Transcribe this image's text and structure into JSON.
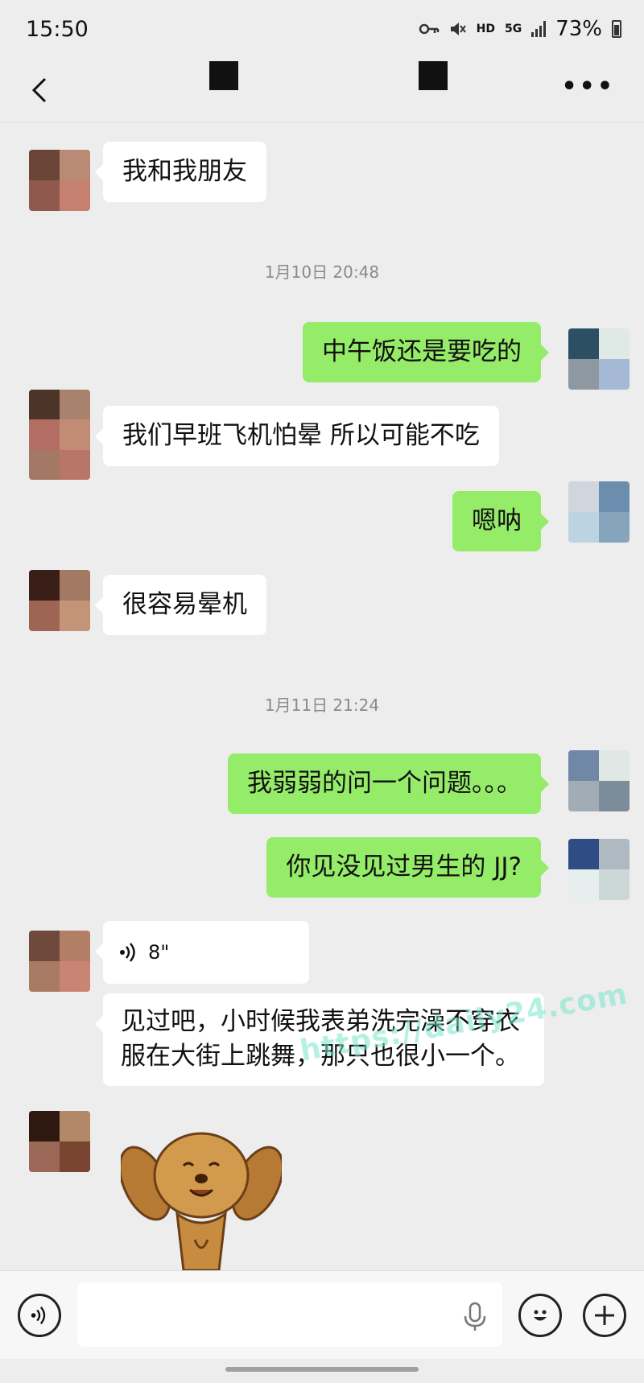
{
  "status": {
    "time": "15:50",
    "net_hd": "HD",
    "net_5g": "5G",
    "battery": "73%"
  },
  "messages": {
    "m1": "我和我朋友",
    "ts1": "1月10日 20:48",
    "m2": "中午饭还是要吃的",
    "m3": "我们早班飞机怕晕 所以可能不吃",
    "m4": "嗯呐",
    "m5": "很容易晕机",
    "ts2": "1月11日 21:24",
    "m6": "我弱弱的问一个问题。。。",
    "m7": "你见没见过男生的 JJ?",
    "voice_duration": "8\"",
    "m8": "见过吧，小时候我表弟洗完澡不穿衣服在大街上跳舞，那只也很小一个。"
  },
  "watermark": "https://daily24.com",
  "colors": {
    "bg": "#ededed",
    "bubble_right": "#95ec69",
    "bubble_left": "#ffffff"
  }
}
